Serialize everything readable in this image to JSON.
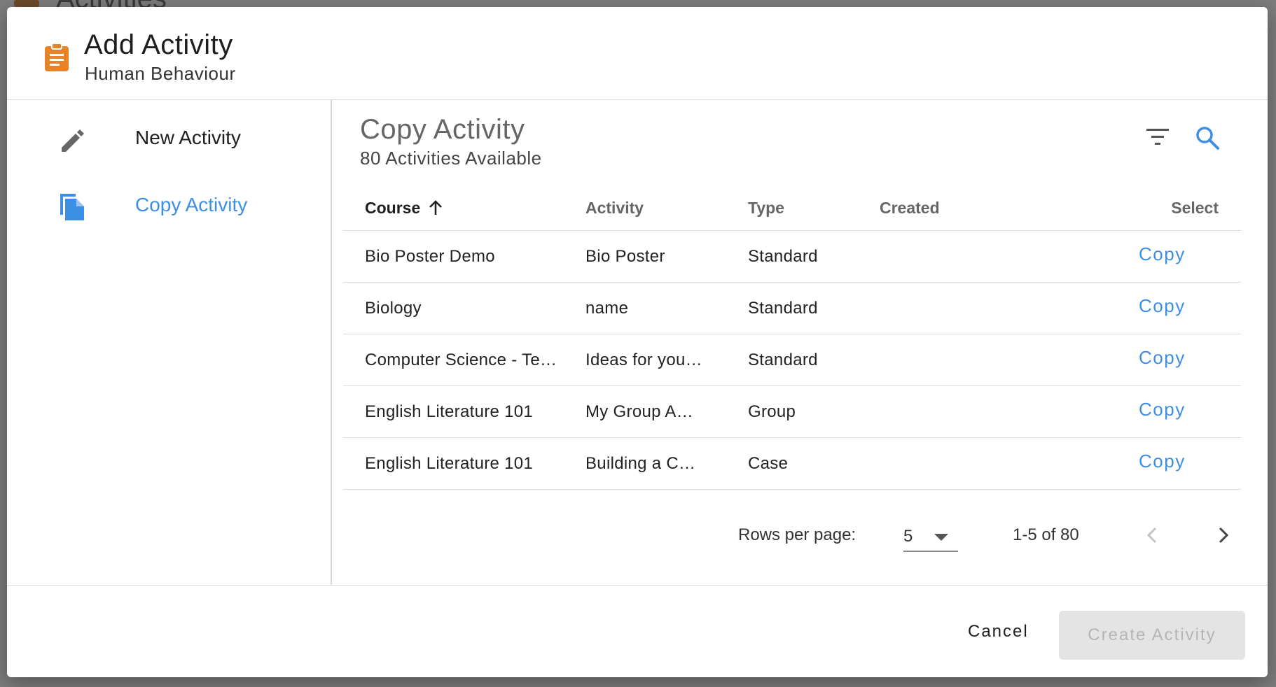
{
  "background": {
    "page_title": "Activities"
  },
  "header": {
    "title": "Add Activity",
    "subtitle": "Human Behaviour"
  },
  "sidebar": {
    "items": [
      {
        "label": "New Activity",
        "icon": "pencil-icon"
      },
      {
        "label": "Copy Activity",
        "icon": "file-copy-icon",
        "selected": true
      }
    ]
  },
  "main": {
    "title": "Copy Activity",
    "subtitle": "80 Activities Available",
    "columns": [
      "Course",
      "Activity",
      "Type",
      "Created",
      "Select"
    ],
    "sort": {
      "column": "Course",
      "direction": "ascending"
    },
    "rows": [
      {
        "course": "Bio Poster Demo",
        "activity": "Bio Poster",
        "type": "Standard",
        "created": "",
        "action": "Copy"
      },
      {
        "course": "Biology",
        "activity": "name",
        "type": "Standard",
        "created": "",
        "action": "Copy"
      },
      {
        "course": "Computer Science - Te…",
        "activity": "Ideas for you…",
        "type": "Standard",
        "created": "",
        "action": "Copy"
      },
      {
        "course": "English Literature 101",
        "activity": "My Group A…",
        "type": "Group",
        "created": "",
        "action": "Copy"
      },
      {
        "course": "English Literature 101",
        "activity": "Building a C…",
        "type": "Case",
        "created": "",
        "action": "Copy"
      }
    ],
    "pagination": {
      "rows_per_page_label": "Rows per page:",
      "rows_per_page": "5",
      "range": "1-5 of 80"
    }
  },
  "footer": {
    "cancel_label": "Cancel",
    "create_label": "Create Activity"
  },
  "colors": {
    "accent": "#3d8fe6",
    "header_icon": "#e8832a",
    "icon_gray": "#666666",
    "disabled_bg": "#e4e4e4",
    "disabled_text": "#b5b5b5"
  }
}
